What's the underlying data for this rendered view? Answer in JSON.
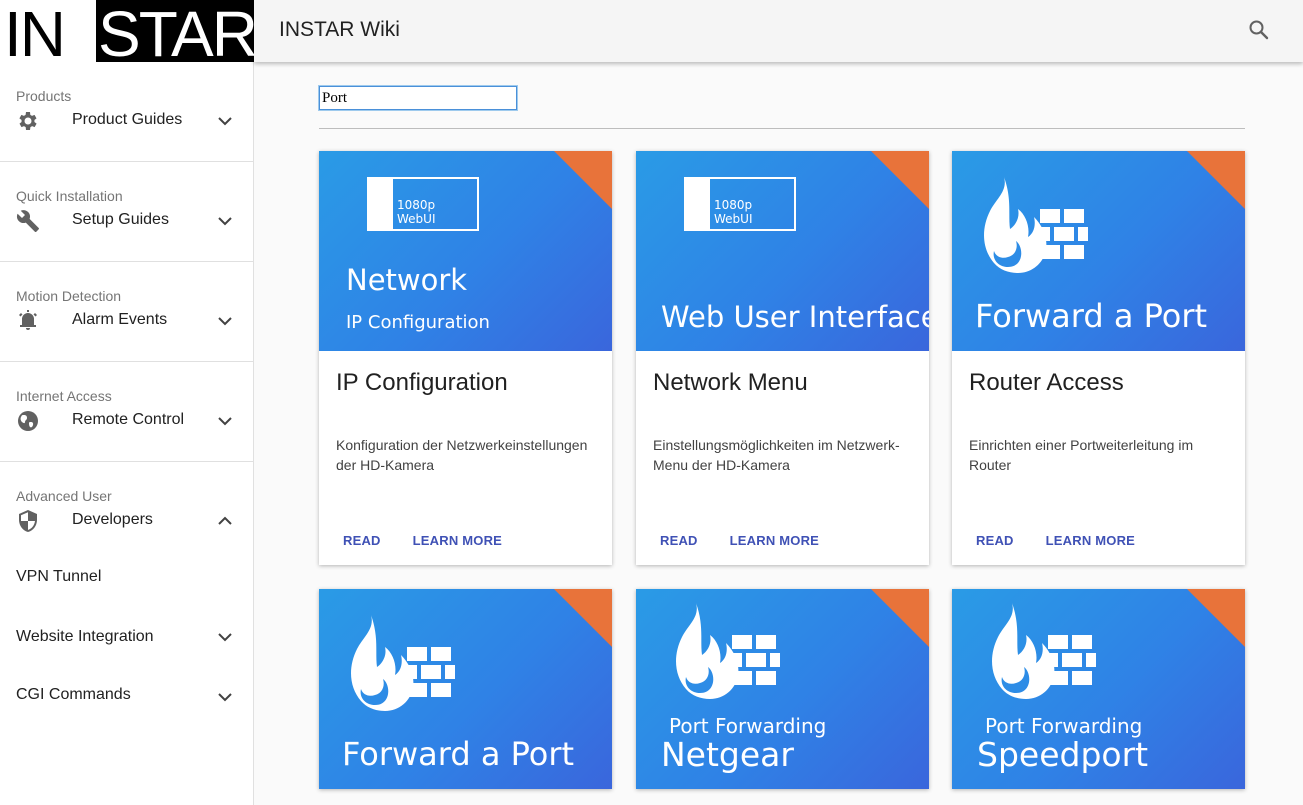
{
  "logo": {
    "left": "IN",
    "right": "STAR"
  },
  "appbar": {
    "title": "INSTAR Wiki",
    "search_icon": "search-icon"
  },
  "sidebar": {
    "sections": [
      {
        "header": "Products",
        "item": {
          "label": "Product Guides",
          "icon": "gear-icon",
          "expanded": false
        }
      },
      {
        "header": "Quick Installation",
        "item": {
          "label": "Setup Guides",
          "icon": "wrench-icon",
          "expanded": false
        }
      },
      {
        "header": "Motion Detection",
        "item": {
          "label": "Alarm Events",
          "icon": "alarm-icon",
          "expanded": false
        }
      },
      {
        "header": "Internet Access",
        "item": {
          "label": "Remote Control",
          "icon": "globe-icon",
          "expanded": false
        }
      },
      {
        "header": "Advanced User",
        "item": {
          "label": "Developers",
          "icon": "shield-icon",
          "expanded": true
        }
      }
    ],
    "sub_items": [
      {
        "label": "VPN Tunnel",
        "has_chevron": false
      },
      {
        "label": "Website Integration",
        "has_chevron": true
      },
      {
        "label": "CGI Commands",
        "has_chevron": true
      }
    ]
  },
  "search": {
    "value": "Port"
  },
  "cards": [
    {
      "media_title": "Network",
      "media_subtitle": "IP Configuration",
      "media_badge": "1080p WebUI",
      "title": "IP Configuration",
      "description": "Konfiguration der Netzwerkeinstellungen der HD-Kamera",
      "read_label": "READ",
      "learn_label": "LEARN MORE"
    },
    {
      "media_title": "Web User Interface",
      "media_badge": "1080p WebUI",
      "title": "Network Menu",
      "description": "Einstellungsmöglichkeiten im Netzwerk-Menu der HD-Kamera",
      "read_label": "READ",
      "learn_label": "LEARN MORE"
    },
    {
      "media_title": "Forward a Port",
      "title": "Router Access",
      "description": "Einrichten einer Portweiterleitung im Router",
      "read_label": "READ",
      "learn_label": "LEARN MORE"
    },
    {
      "media_title": "Forward a Port"
    },
    {
      "media_subtitle": "Port Forwarding",
      "media_title": "Netgear"
    },
    {
      "media_subtitle": "Port Forwarding",
      "media_title": "Speedport"
    }
  ],
  "colors": {
    "accent": "#3f51b5",
    "corner": "#e8733a",
    "media_blue": "#2f82e6"
  }
}
